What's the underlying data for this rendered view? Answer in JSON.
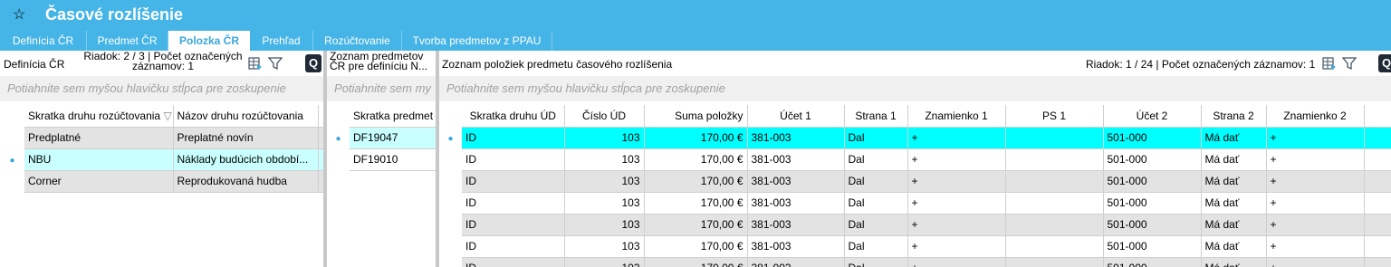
{
  "app": {
    "title": "Časové rozlíšenie",
    "star_icon": "star-icon"
  },
  "tabs": [
    {
      "label": "Definícia ČR",
      "active": false
    },
    {
      "label": "Predmet ČR",
      "active": false
    },
    {
      "label": "Polozka ČR",
      "active": true
    },
    {
      "label": "Prehľad",
      "active": false
    },
    {
      "label": "Rozúčtovanie",
      "active": false
    },
    {
      "label": "Tvorba predmetov z PPAU",
      "active": false
    }
  ],
  "left_panel": {
    "title": "Definícia ČR",
    "info_line1": "Riadok: 2 / 3 | Počet označených",
    "info_line2": "záznamov: 1",
    "group_hint": "Potiahnite sem myšou hlavičku stĺpca pre zoskupenie",
    "columns": [
      "Skratka druhu rozúčtovania",
      "Názov druhu rozúčtovania"
    ],
    "rows": [
      [
        "Predplatné",
        "Preplatné novín"
      ],
      [
        "NBU",
        "Náklady budúcich období..."
      ],
      [
        "Corner",
        "Reprodukovaná hudba"
      ]
    ]
  },
  "middle_panel": {
    "title_line1": "Zoznam predmetov",
    "title_line2": "ČR pre definíciu N...",
    "group_hint": "Potiahnite sem my",
    "columns": [
      "Skratka predmet"
    ],
    "rows": [
      [
        "DF19047"
      ],
      [
        "DF19010"
      ]
    ]
  },
  "right_panel": {
    "title": "Zoznam položiek predmetu časového rozlíšenia",
    "info": "Riadok: 1 / 24 | Počet označených záznamov: 1",
    "group_hint": "Potiahnite sem myšou hlavičku stĺpca pre zoskupenie",
    "columns": [
      "Skratka druhu ÚD",
      "Číslo ÚD",
      "Suma položky",
      "Účet 1",
      "Strana 1",
      "Znamienko 1",
      "PS 1",
      "Účet 2",
      "Strana 2",
      "Znamienko 2"
    ],
    "rows": [
      [
        "ID",
        "103",
        "170,00 €",
        "381-003",
        "Dal",
        "+",
        "",
        "501-000",
        "Má dať",
        "+"
      ],
      [
        "ID",
        "103",
        "170,00 €",
        "381-003",
        "Dal",
        "+",
        "",
        "501-000",
        "Má dať",
        "+"
      ],
      [
        "ID",
        "103",
        "170,00 €",
        "381-003",
        "Dal",
        "+",
        "",
        "501-000",
        "Má dať",
        "+"
      ],
      [
        "ID",
        "103",
        "170,00 €",
        "381-003",
        "Dal",
        "+",
        "",
        "501-000",
        "Má dať",
        "+"
      ],
      [
        "ID",
        "103",
        "170,00 €",
        "381-003",
        "Dal",
        "+",
        "",
        "501-000",
        "Má dať",
        "+"
      ],
      [
        "ID",
        "103",
        "170,00 €",
        "381-003",
        "Dal",
        "+",
        "",
        "501-000",
        "Má dať",
        "+"
      ],
      [
        "ID",
        "103",
        "170,00 €",
        "381-003",
        "Dal",
        "+",
        "",
        "501-000",
        "Má dať",
        "+"
      ]
    ]
  },
  "colors": {
    "accent": "#45b4e6",
    "selected_row": "#00ffff"
  }
}
